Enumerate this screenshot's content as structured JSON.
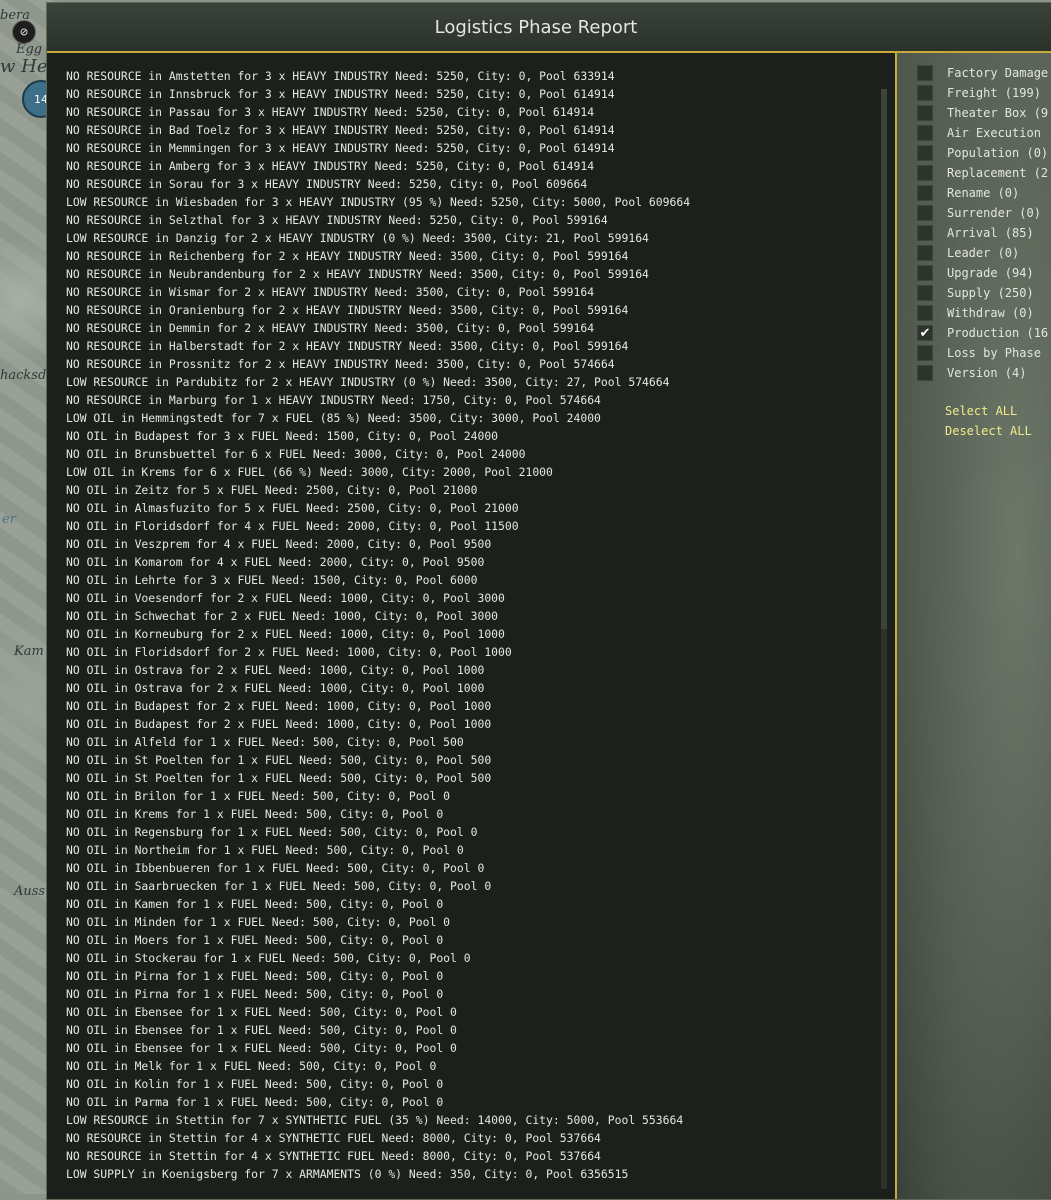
{
  "window": {
    "title": "Logistics Phase Report"
  },
  "map": {
    "labels": [
      "bera",
      "Egg",
      "w He",
      "hacksd",
      "er",
      "Kam",
      "Auss"
    ],
    "counter_value": "14"
  },
  "report_lines": [
    "NO RESOURCE in Amstetten for 3 x HEAVY INDUSTRY Need: 5250, City: 0, Pool 633914",
    "NO RESOURCE in Innsbruck for 3 x HEAVY INDUSTRY Need: 5250, City: 0, Pool 614914",
    "NO RESOURCE in Passau for 3 x HEAVY INDUSTRY Need: 5250, City: 0, Pool 614914",
    "NO RESOURCE in Bad Toelz for 3 x HEAVY INDUSTRY Need: 5250, City: 0, Pool 614914",
    "NO RESOURCE in Memmingen for 3 x HEAVY INDUSTRY Need: 5250, City: 0, Pool 614914",
    "NO RESOURCE in Amberg for 3 x HEAVY INDUSTRY Need: 5250, City: 0, Pool 614914",
    "NO RESOURCE in Sorau for 3 x HEAVY INDUSTRY Need: 5250, City: 0, Pool 609664",
    "LOW RESOURCE in Wiesbaden for 3 x HEAVY INDUSTRY (95 %) Need: 5250, City: 5000, Pool 609664",
    "NO RESOURCE in Selzthal for 3 x HEAVY INDUSTRY Need: 5250, City: 0, Pool 599164",
    "LOW RESOURCE in Danzig for 2 x HEAVY INDUSTRY (0 %) Need: 3500, City: 21, Pool 599164",
    "NO RESOURCE in Reichenberg for 2 x HEAVY INDUSTRY Need: 3500, City: 0, Pool 599164",
    "NO RESOURCE in Neubrandenburg for 2 x HEAVY INDUSTRY Need: 3500, City: 0, Pool 599164",
    "NO RESOURCE in Wismar for 2 x HEAVY INDUSTRY Need: 3500, City: 0, Pool 599164",
    "NO RESOURCE in Oranienburg for 2 x HEAVY INDUSTRY Need: 3500, City: 0, Pool 599164",
    "NO RESOURCE in Demmin for 2 x HEAVY INDUSTRY Need: 3500, City: 0, Pool 599164",
    "NO RESOURCE in Halberstadt for 2 x HEAVY INDUSTRY Need: 3500, City: 0, Pool 599164",
    "NO RESOURCE in Prossnitz for 2 x HEAVY INDUSTRY Need: 3500, City: 0, Pool 574664",
    "LOW RESOURCE in Pardubitz for 2 x HEAVY INDUSTRY (0 %) Need: 3500, City: 27, Pool 574664",
    "NO RESOURCE in Marburg for 1 x HEAVY INDUSTRY Need: 1750, City: 0, Pool 574664",
    "LOW OIL in Hemmingstedt for 7 x FUEL (85 %) Need: 3500, City: 3000, Pool 24000",
    "NO OIL in Budapest for 3 x FUEL Need: 1500, City: 0, Pool 24000",
    "NO OIL in Brunsbuettel for 6 x FUEL Need: 3000, City: 0, Pool 24000",
    "LOW OIL in Krems for 6 x FUEL (66 %) Need: 3000, City: 2000, Pool 21000",
    "NO OIL in Zeitz for 5 x FUEL Need: 2500, City: 0, Pool 21000",
    "NO OIL in Almasfuzito for 5 x FUEL Need: 2500, City: 0, Pool 21000",
    "NO OIL in Floridsdorf for 4 x FUEL Need: 2000, City: 0, Pool 11500",
    "NO OIL in Veszprem for 4 x FUEL Need: 2000, City: 0, Pool 9500",
    "NO OIL in Komarom for 4 x FUEL Need: 2000, City: 0, Pool 9500",
    "NO OIL in Lehrte for 3 x FUEL Need: 1500, City: 0, Pool 6000",
    "NO OIL in Voesendorf for 2 x FUEL Need: 1000, City: 0, Pool 3000",
    "NO OIL in Schwechat for 2 x FUEL Need: 1000, City: 0, Pool 3000",
    "NO OIL in Korneuburg for 2 x FUEL Need: 1000, City: 0, Pool 1000",
    "NO OIL in Floridsdorf for 2 x FUEL Need: 1000, City: 0, Pool 1000",
    "NO OIL in Ostrava for 2 x FUEL Need: 1000, City: 0, Pool 1000",
    "NO OIL in Ostrava for 2 x FUEL Need: 1000, City: 0, Pool 1000",
    "NO OIL in Budapest for 2 x FUEL Need: 1000, City: 0, Pool 1000",
    "NO OIL in Budapest for 2 x FUEL Need: 1000, City: 0, Pool 1000",
    "NO OIL in Alfeld for 1 x FUEL Need: 500, City: 0, Pool 500",
    "NO OIL in St Poelten for 1 x FUEL Need: 500, City: 0, Pool 500",
    "NO OIL in St Poelten for 1 x FUEL Need: 500, City: 0, Pool 500",
    "NO OIL in Brilon for 1 x FUEL Need: 500, City: 0, Pool 0",
    "NO OIL in Krems for 1 x FUEL Need: 500, City: 0, Pool 0",
    "NO OIL in Regensburg for 1 x FUEL Need: 500, City: 0, Pool 0",
    "NO OIL in Northeim for 1 x FUEL Need: 500, City: 0, Pool 0",
    "NO OIL in Ibbenbueren for 1 x FUEL Need: 500, City: 0, Pool 0",
    "NO OIL in Saarbruecken for 1 x FUEL Need: 500, City: 0, Pool 0",
    "NO OIL in Kamen for 1 x FUEL Need: 500, City: 0, Pool 0",
    "NO OIL in Minden for 1 x FUEL Need: 500, City: 0, Pool 0",
    "NO OIL in Moers for 1 x FUEL Need: 500, City: 0, Pool 0",
    "NO OIL in Stockerau for 1 x FUEL Need: 500, City: 0, Pool 0",
    "NO OIL in Pirna for 1 x FUEL Need: 500, City: 0, Pool 0",
    "NO OIL in Pirna for 1 x FUEL Need: 500, City: 0, Pool 0",
    "NO OIL in Ebensee for 1 x FUEL Need: 500, City: 0, Pool 0",
    "NO OIL in Ebensee for 1 x FUEL Need: 500, City: 0, Pool 0",
    "NO OIL in Ebensee for 1 x FUEL Need: 500, City: 0, Pool 0",
    "NO OIL in Melk for 1 x FUEL Need: 500, City: 0, Pool 0",
    "NO OIL in Kolin for 1 x FUEL Need: 500, City: 0, Pool 0",
    "NO OIL in Parma for 1 x FUEL Need: 500, City: 0, Pool 0",
    "LOW RESOURCE in Stettin for 7 x SYNTHETIC FUEL (35 %) Need: 14000, City: 5000, Pool 553664",
    "NO RESOURCE in Stettin for 4 x SYNTHETIC FUEL Need: 8000, City: 0, Pool 537664",
    "NO RESOURCE in Stettin for 4 x SYNTHETIC FUEL Need: 8000, City: 0, Pool 537664",
    "LOW SUPPLY in Koenigsberg for 7 x ARMAMENTS (0 %) Need: 350, City: 0, Pool 6356515"
  ],
  "filters": [
    {
      "label": "Factory Damage",
      "checked": false
    },
    {
      "label": "Freight  (199)",
      "checked": false
    },
    {
      "label": "Theater Box  (9",
      "checked": false
    },
    {
      "label": "Air Execution",
      "checked": false
    },
    {
      "label": "Population  (0)",
      "checked": false
    },
    {
      "label": "Replacement  (2",
      "checked": false
    },
    {
      "label": "Rename  (0)",
      "checked": false
    },
    {
      "label": "Surrender  (0)",
      "checked": false
    },
    {
      "label": "Arrival  (85)",
      "checked": false
    },
    {
      "label": "Leader  (0)",
      "checked": false
    },
    {
      "label": "Upgrade  (94)",
      "checked": false
    },
    {
      "label": "Supply  (250)",
      "checked": false
    },
    {
      "label": "Withdraw  (0)",
      "checked": false
    },
    {
      "label": "Production  (16",
      "checked": true
    },
    {
      "label": "Loss by Phase",
      "checked": false
    },
    {
      "label": "Version  (4)",
      "checked": false
    }
  ],
  "actions": {
    "select_all": "Select ALL",
    "deselect_all": "Deselect ALL"
  },
  "icons": {
    "checkmark": "✔",
    "map_badge": "⊘"
  },
  "colors": {
    "accent_gold": "#c9a93a",
    "link_yellow": "#f1ec8a",
    "text": "#e4e8e4"
  }
}
